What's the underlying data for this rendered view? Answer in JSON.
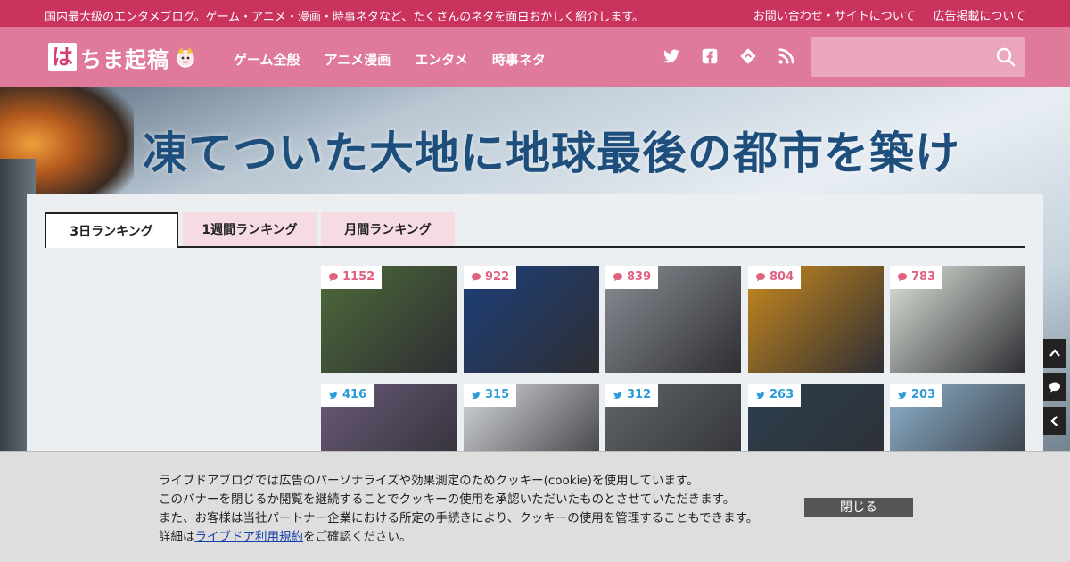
{
  "topbar": {
    "tagline": "国内最大級のエンタメブログ。ゲーム・アニメ・漫画・時事ネタなど、たくさんのネタを面白おかしく紹介します。",
    "links": [
      {
        "label": "お問い合わせ・サイトについて"
      },
      {
        "label": "広告掲載について"
      }
    ]
  },
  "header": {
    "logo_first": "は",
    "logo_rest": "ちま起稿",
    "menu": [
      {
        "label": "ゲーム全般"
      },
      {
        "label": "アニメ漫画"
      },
      {
        "label": "エンタメ"
      },
      {
        "label": "時事ネタ"
      }
    ],
    "social_icons": [
      "twitter-icon",
      "facebook-icon",
      "feedly-icon",
      "rss-icon"
    ],
    "search_placeholder": ""
  },
  "banner": {
    "headline": "凍てついた大地に地球最後の都市を築け"
  },
  "ranking": {
    "tabs": [
      {
        "label": "3日ランキング",
        "active": true
      },
      {
        "label": "1週間ランキング",
        "active": false
      },
      {
        "label": "月間ランキング",
        "active": false
      }
    ],
    "items": [
      {
        "type": "comment",
        "count": "1152",
        "color": "#4e6b3a"
      },
      {
        "type": "comment",
        "count": "922",
        "color": "#1d3f7a"
      },
      {
        "type": "comment",
        "count": "839",
        "color": "#8a8f95"
      },
      {
        "type": "comment",
        "count": "804",
        "color": "#c98a1e"
      },
      {
        "type": "comment",
        "count": "783",
        "color": "#dfe6dc"
      },
      {
        "type": "tweet",
        "count": "416",
        "color": "#6a5a78"
      },
      {
        "type": "tweet",
        "count": "315",
        "color": "#d6d9de"
      },
      {
        "type": "tweet",
        "count": "312",
        "color": "#5f6568"
      },
      {
        "type": "tweet",
        "count": "263",
        "color": "#2b3f4e"
      },
      {
        "type": "tweet",
        "count": "203",
        "color": "#8fb3cf"
      }
    ]
  },
  "cookie": {
    "line1": "ライブドアブログでは広告のパーソナライズや効果測定のためクッキー(cookie)を使用しています。",
    "line2": "このバナーを閉じるか閲覧を継続することでクッキーの使用を承認いただいたものとさせていただきます。",
    "line3": "また、お客様は当社パートナー企業における所定の手続きにより、クッキーの使用を管理することもできます。",
    "line4_prefix": "詳細は",
    "line4_link": "ライブドア利用規約",
    "line4_suffix": "をご確認ください。",
    "close_label": "閉じる"
  },
  "colors": {
    "topbar": "#c9335e",
    "nav": "#e07a9a",
    "comment": "#e0617f",
    "tweet": "#2a9bd8"
  }
}
